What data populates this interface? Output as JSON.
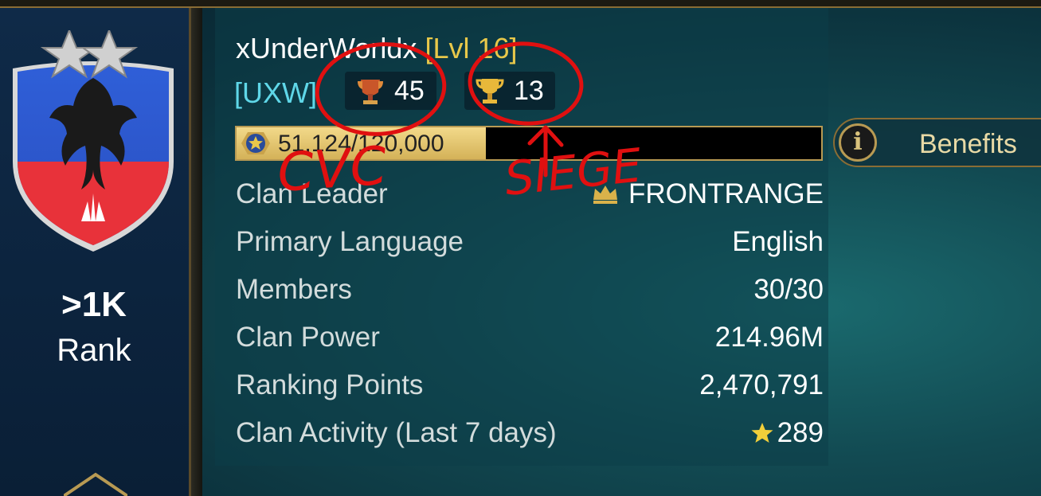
{
  "clan": {
    "name": "xUnderWorldx",
    "level": "[Lvl 16]",
    "tag": "[UXW]",
    "cvc_count": "45",
    "siege_count": "13"
  },
  "progress": {
    "text": "51,124/120,000",
    "fraction": 0.426
  },
  "benefits": {
    "label": "Benefits",
    "icon": "i"
  },
  "rank": {
    "value": ">1K",
    "label": "Rank"
  },
  "stats": [
    {
      "label": "Clan Leader",
      "value": "FRONTRANGE",
      "icon": "crown-icon"
    },
    {
      "label": "Primary Language",
      "value": "English"
    },
    {
      "label": "Members",
      "value": "30/30"
    },
    {
      "label": "Clan Power",
      "value": "214.96M"
    },
    {
      "label": "Ranking Points",
      "value": "2,470,791"
    },
    {
      "label": "Clan Activity (Last 7 days)",
      "value": "289",
      "icon": "star-icon"
    }
  ],
  "annotations": {
    "cvc": "CVC",
    "siege": "SIEGE"
  },
  "colors": {
    "accent_gold": "#e8c84a",
    "tag_cyan": "#5fd7e8",
    "annotation_red": "#e01010"
  }
}
